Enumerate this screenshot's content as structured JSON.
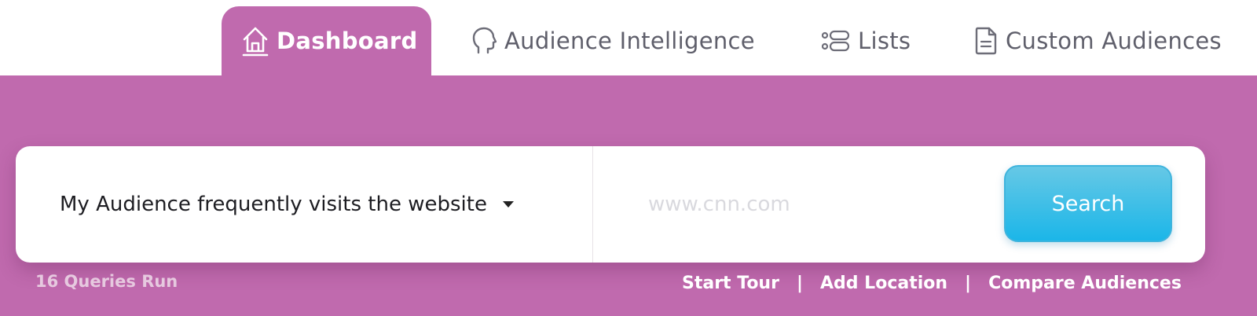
{
  "nav": {
    "tabs": [
      {
        "label": "Dashboard",
        "icon": "home-icon",
        "active": true
      },
      {
        "label": "Audience Intelligence",
        "icon": "head-profile-icon",
        "active": false
      },
      {
        "label": "Lists",
        "icon": "list-icon",
        "active": false
      },
      {
        "label": "Custom Audiences",
        "icon": "document-icon",
        "active": false
      }
    ]
  },
  "search": {
    "selector_value": "My Audience frequently visits the website",
    "placeholder": "www.cnn.com",
    "button_label": "Search"
  },
  "footer": {
    "queries_text": "16 Queries Run",
    "links": [
      "Start Tour",
      "Add Location",
      "Compare Audiences"
    ],
    "separator": "|"
  },
  "colors": {
    "brand": "#c06aae",
    "search_button": "#1bb6e8"
  }
}
